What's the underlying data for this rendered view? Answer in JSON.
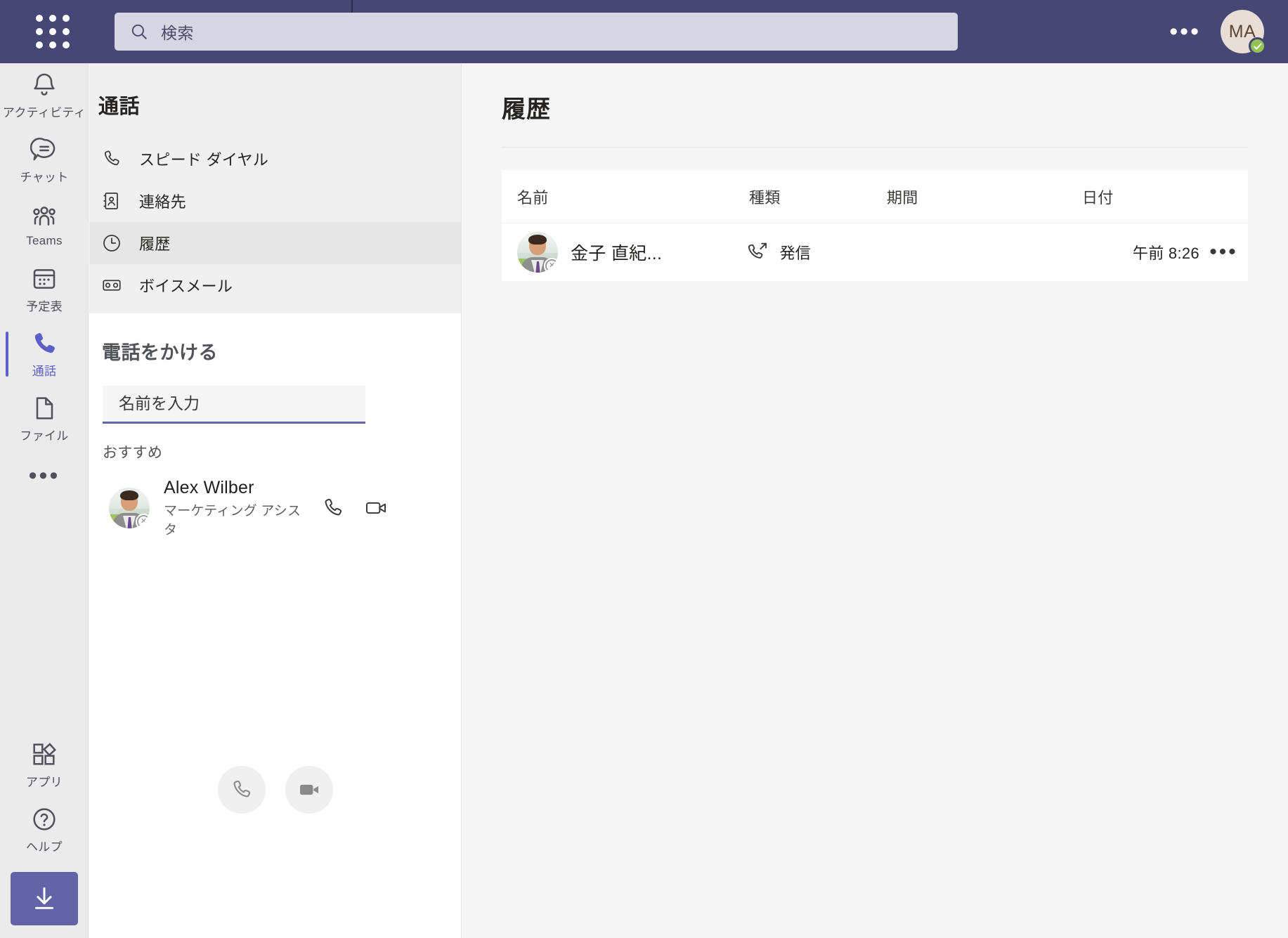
{
  "topbar": {
    "app_launcher_icon": "grid-dots-icon",
    "search": {
      "icon": "search-icon",
      "placeholder": "検索",
      "value": ""
    },
    "more_label": "•••",
    "avatar": {
      "initials": "MA",
      "presence": "available",
      "presence_color": "#92c353"
    }
  },
  "rail": {
    "items": [
      {
        "label": "アクティビティ",
        "icon": "bell-icon",
        "active": false
      },
      {
        "label": "チャット",
        "icon": "chat-icon",
        "active": false
      },
      {
        "label": "Teams",
        "icon": "people-icon",
        "active": false
      },
      {
        "label": "予定表",
        "icon": "calendar-icon",
        "active": false
      },
      {
        "label": "通話",
        "icon": "phone-icon",
        "active": true
      },
      {
        "label": "ファイル",
        "icon": "file-icon",
        "active": false
      }
    ],
    "more_label": "•••",
    "apps": {
      "label": "アプリ",
      "icon": "apps-icon"
    },
    "help": {
      "label": "ヘルプ",
      "icon": "help-icon"
    },
    "download": {
      "icon": "download-icon"
    }
  },
  "calls_panel": {
    "title": "通話",
    "nav_items": [
      {
        "label": "スピード ダイヤル",
        "icon": "phone-outline-icon",
        "selected": false
      },
      {
        "label": "連絡先",
        "icon": "contact-card-icon",
        "selected": false
      },
      {
        "label": "履歴",
        "icon": "clock-icon",
        "selected": true
      },
      {
        "label": "ボイスメール",
        "icon": "voicemail-icon",
        "selected": false
      }
    ],
    "make_call": {
      "title": "電話をかける",
      "input": {
        "placeholder": "名前を入力",
        "value": ""
      },
      "suggested_label": "おすすめ",
      "suggestions": [
        {
          "name": "Alex Wilber",
          "subtitle": "マーケティング アシスタ",
          "presence": "offline",
          "avatar": "photo",
          "actions": [
            {
              "icon": "phone-call-icon",
              "label": "音声通話"
            },
            {
              "icon": "video-call-icon",
              "label": "ビデオ通話"
            }
          ]
        }
      ],
      "dialpad_buttons": [
        {
          "icon": "phone-call-icon"
        },
        {
          "icon": "video-call-icon"
        }
      ]
    }
  },
  "main": {
    "title": "履歴",
    "table": {
      "columns": [
        "名前",
        "種類",
        "期間",
        "日付"
      ],
      "rows": [
        {
          "name": "金子 直紀...",
          "type": "発信",
          "type_icon": "outgoing-call-icon",
          "duration": "",
          "date": "午前 8:26",
          "presence": "offline",
          "avatar": "photo",
          "more_label": "•••"
        }
      ]
    }
  },
  "colors": {
    "brand_purple": "#464775",
    "accent_purple": "#6264a7",
    "active_purple": "#5b5fc7",
    "presence_available": "#92c353",
    "panel_gray": "#f0f0f0",
    "rail_gray": "#ebebeb",
    "main_bg": "#f5f5f5"
  }
}
